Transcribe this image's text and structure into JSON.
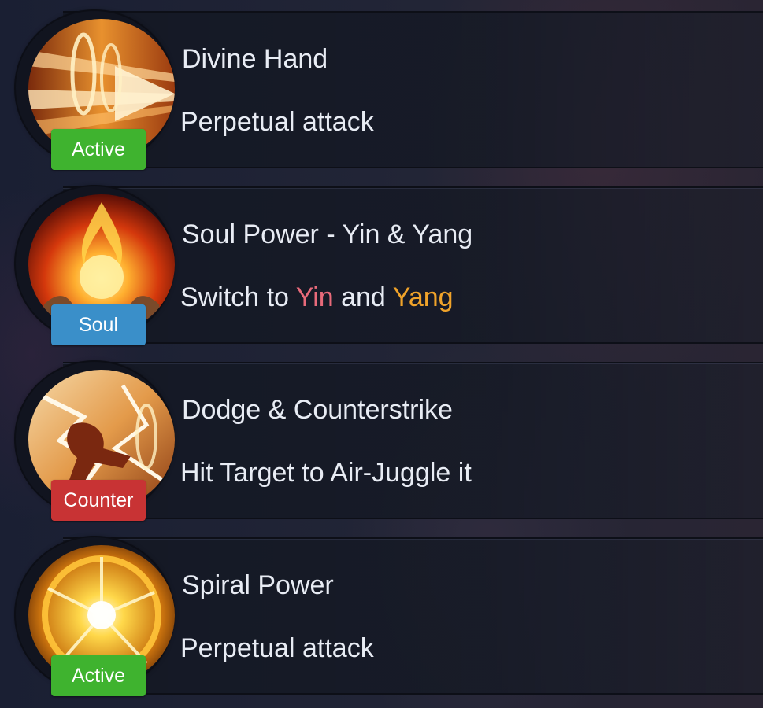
{
  "skills": [
    {
      "name": "Divine Hand",
      "description": "Perpetual attack",
      "badge": "Active",
      "badge_color": "#3fb32f",
      "icon": "golden-palm-strike-icon"
    },
    {
      "name": "Soul Power - Yin & Yang",
      "description_prefix": "Switch to ",
      "description_yin": "Yin",
      "description_middle": " and ",
      "description_yang": "Yang",
      "yin_color": "#e86a7a",
      "yang_color": "#f0a32a",
      "badge": "Soul",
      "badge_color": "#3a8fc9",
      "icon": "fire-orb-hands-icon"
    },
    {
      "name": "Dodge & Counterstrike",
      "description": "Hit Target to Air-Juggle it",
      "badge": "Counter",
      "badge_color": "#c83334",
      "icon": "counter-kick-icon"
    },
    {
      "name": "Spiral Power",
      "description": "Perpetual attack",
      "badge": "Active",
      "badge_color": "#3fb32f",
      "icon": "spiral-burst-icon"
    }
  ]
}
